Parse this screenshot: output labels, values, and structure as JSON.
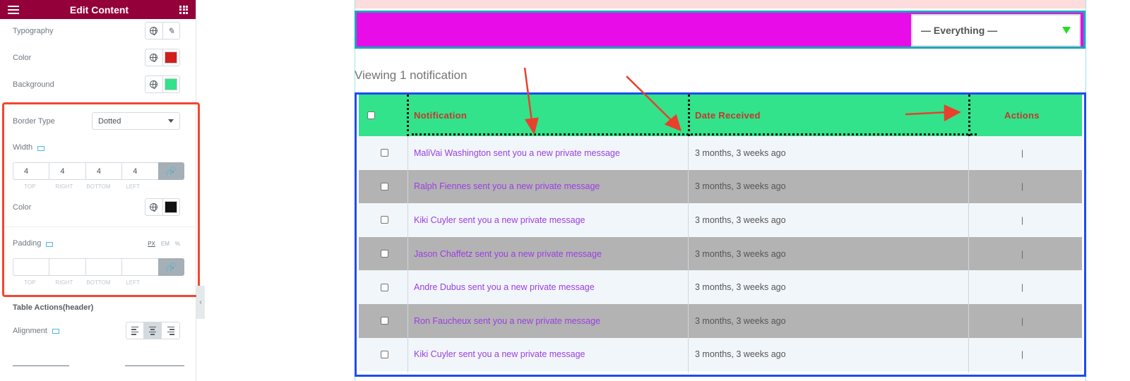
{
  "panel": {
    "title": "Edit Content",
    "typography_label": "Typography",
    "color_label": "Color",
    "color_value": "#d0201c",
    "background_label": "Background",
    "background_value": "#32e38b",
    "border_type_label": "Border Type",
    "border_type_value": "Dotted",
    "width_label": "Width",
    "width_values": {
      "top": "4",
      "right": "4",
      "bottom": "4",
      "left": "4"
    },
    "dim_labels": {
      "top": "TOP",
      "right": "RIGHT",
      "bottom": "BOTTOM",
      "left": "LEFT"
    },
    "border_color_label": "Color",
    "border_color_value": "#111111",
    "padding_label": "Padding",
    "units": {
      "px": "PX",
      "em": "EM",
      "pct": "%"
    },
    "section_title": "Table Actions(header)",
    "alignment_label": "Alignment",
    "collapse_glyph": "‹"
  },
  "preview": {
    "filter_value": "— Everything —",
    "viewing_text": "Viewing 1 notification",
    "columns": {
      "notification": "Notification",
      "date": "Date Received",
      "actions": "Actions"
    },
    "rows": [
      {
        "message": "MaliVai Washington sent you a new private message",
        "date": "3 months, 3 weeks ago",
        "actions": "|"
      },
      {
        "message": "Ralph Fiennes sent you a new private message",
        "date": "3 months, 3 weeks ago",
        "actions": "|"
      },
      {
        "message": "Kiki Cuyler sent you a new private message",
        "date": "3 months, 3 weeks ago",
        "actions": "|"
      },
      {
        "message": "Jason Chaffetz sent you a new private message",
        "date": "3 months, 3 weeks ago",
        "actions": "|"
      },
      {
        "message": "Andre Dubus sent you a new private message",
        "date": "3 months, 3 weeks ago",
        "actions": "|"
      },
      {
        "message": "Ron Faucheux sent you a new private message",
        "date": "3 months, 3 weeks ago",
        "actions": "|"
      },
      {
        "message": "Kiki Cuyler sent you a new private message",
        "date": "3 months, 3 weeks ago",
        "actions": "|"
      }
    ],
    "colors": {
      "header_bg": "#32e38b",
      "header_text": "#c0392b",
      "message_text": "#9b3ee2",
      "filter_bar": "#e80de8",
      "table_border": "#1d4bf5",
      "arrow": "#e8402d"
    }
  }
}
